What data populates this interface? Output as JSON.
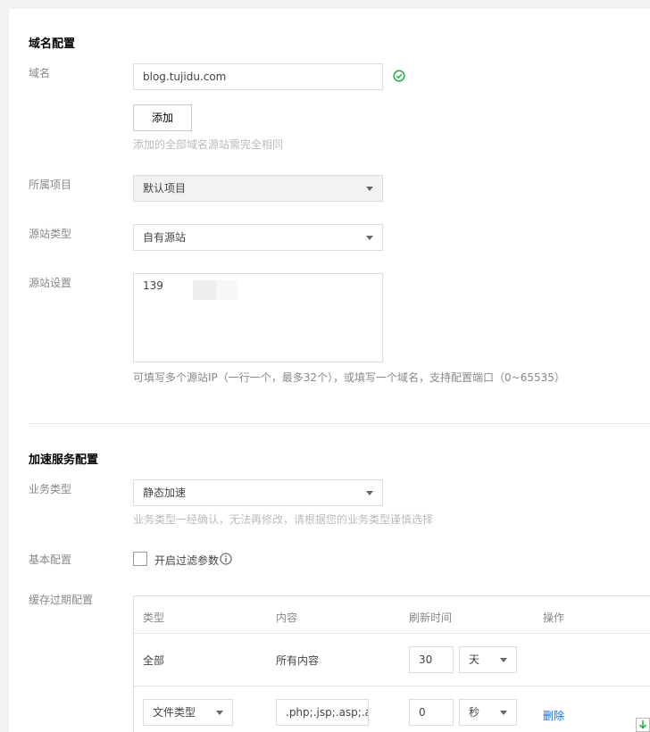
{
  "domain_section": {
    "title": "域名配置",
    "domain_label": "域名",
    "domain_value": "blog.tujidu.com",
    "add_button": "添加",
    "add_hint": "添加的全部域名源站需完全相同",
    "project_label": "所属项目",
    "project_value": "默认项目",
    "origin_type_label": "源站类型",
    "origin_type_value": "自有源站",
    "origin_setting_label": "源站设置",
    "origin_setting_value": "139",
    "origin_hint": "可填写多个源站IP（一行一个，最多32个），或填写一个域名，支持配置端口（0~65535）"
  },
  "acceleration_section": {
    "title": "加速服务配置",
    "business_type_label": "业务类型",
    "business_type_value": "静态加速",
    "business_hint": "业务类型一经确认，无法再修改，请根据您的业务类型谨慎选择",
    "basic_config_label": "基本配置",
    "filter_param_label": "开启过滤参数",
    "cache_label": "缓存过期配置"
  },
  "cache_table": {
    "headers": [
      "类型",
      "内容",
      "刷新时间",
      "操作"
    ],
    "rows": [
      {
        "type": "全部",
        "content": "所有内容",
        "time": "30",
        "unit": "天",
        "action": ""
      },
      {
        "type": "文件类型",
        "content": ".php;.jsp;.asp;.aspx",
        "time": "0",
        "unit": "秒",
        "action": "删除"
      }
    ]
  },
  "colors": {
    "success": "#2bb24c",
    "link": "#006eff",
    "border": "#dddddd"
  },
  "icons": {
    "success": "check-circle-icon",
    "info": "info-icon",
    "dropdown": "caret-down-icon",
    "corner": "download-icon"
  }
}
